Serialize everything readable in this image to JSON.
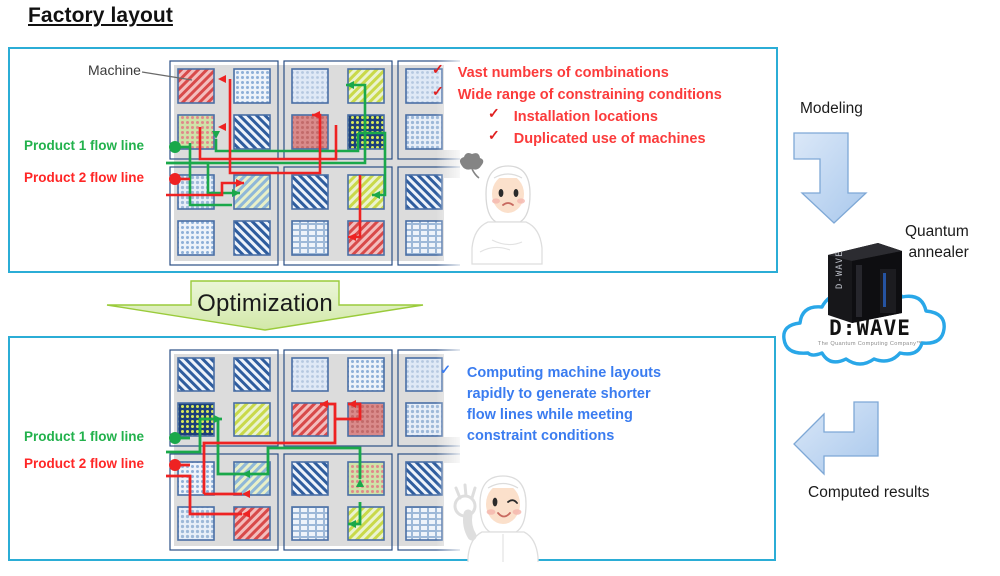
{
  "page": {
    "title": "Factory layout"
  },
  "colors": {
    "panel_border": "#2badd6",
    "flow1_green": "#22b14c",
    "flow2_red": "#ff2626",
    "problem_red": "#fb3b3b",
    "result_blue": "#3a7cf0",
    "optimization_fill": "#dff0c0",
    "optimization_stroke": "#9acb3b",
    "arrow_fill": "#bcd6f2",
    "arrow_stroke": "#7ea8d6",
    "cloud_stroke": "#29a7e8",
    "machine_tile_border": "#4a6fa5"
  },
  "top_panel": {
    "machine_label": "Machine",
    "flow_lines": [
      {
        "label": "Product 1 flow line",
        "color": "#22b14c",
        "marker": "dot"
      },
      {
        "label": "Product 2 flow line",
        "color": "#ff2626",
        "marker": "dot"
      }
    ],
    "bullets": [
      {
        "text": "Vast numbers of combinations",
        "level": 1,
        "check": "✓"
      },
      {
        "text": "Wide range of constraining conditions",
        "level": 1,
        "check": "✓"
      },
      {
        "text": "Installation locations",
        "level": 2,
        "check": "✓"
      },
      {
        "text": "Duplicated use of machines",
        "level": 2,
        "check": "✓"
      }
    ],
    "character": "worried-worker"
  },
  "optimization": {
    "label": "Optimization"
  },
  "bottom_panel": {
    "flow_lines": [
      {
        "label": "Product 1 flow line",
        "color": "#22b14c",
        "marker": "dot"
      },
      {
        "label": "Product 2 flow line",
        "color": "#ff2626",
        "marker": "dot"
      }
    ],
    "bullets": [
      {
        "check": "✓",
        "lines": [
          "Computing machine layouts",
          "rapidly to generate shorter",
          "flow lines while meeting",
          "constraint conditions"
        ]
      }
    ],
    "character": "happy-worker"
  },
  "right_column": {
    "modeling_label": "Modeling",
    "annealer_label_line1": "Quantum",
    "annealer_label_line2": "annealer",
    "computed_label": "Computed results",
    "dwave": {
      "wordmark": "D:WAVE",
      "tagline": "The Quantum Computing Company™",
      "machine_text": "D-WAVE"
    }
  }
}
